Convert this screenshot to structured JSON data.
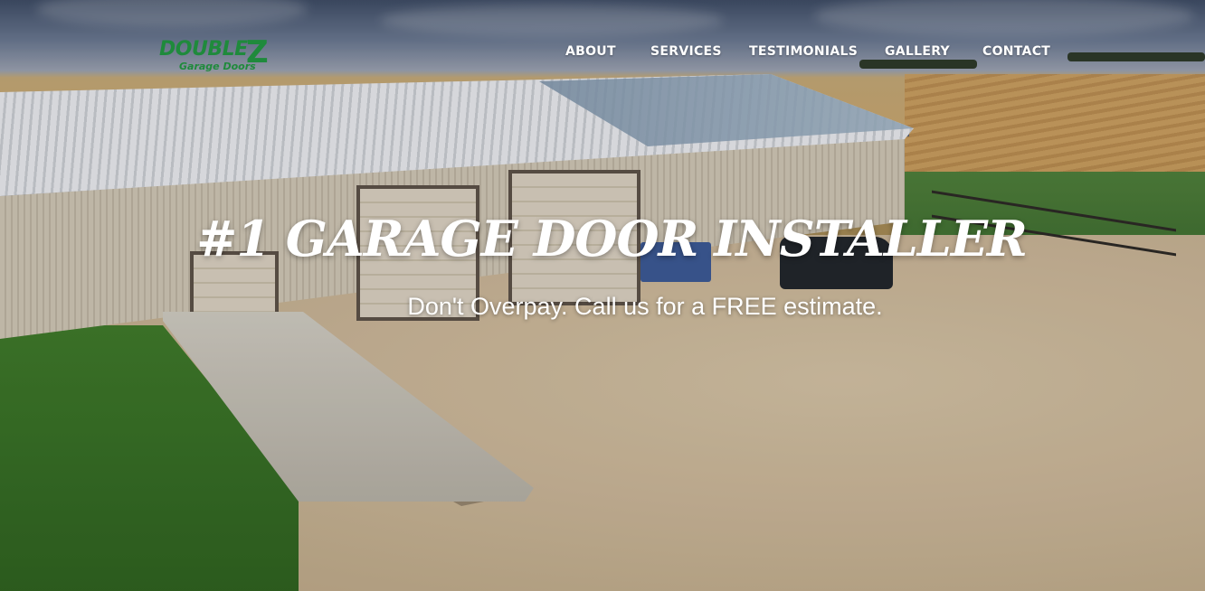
{
  "brand": {
    "logo_text_main": "DOUBLE",
    "logo_text_z": "Z",
    "logo_text_sub": "Garage Doors",
    "logo_color": "#1f8a3c"
  },
  "nav": {
    "items": [
      {
        "label": "ABOUT"
      },
      {
        "label": "SERVICES"
      },
      {
        "label": "TESTIMONIALS"
      },
      {
        "label": "GALLERY"
      },
      {
        "label": "CONTACT"
      }
    ]
  },
  "hero": {
    "headline": "#1 GARAGE DOOR INSTALLER",
    "subheadline": "Don't Overpay. Call us for a FREE estimate."
  }
}
